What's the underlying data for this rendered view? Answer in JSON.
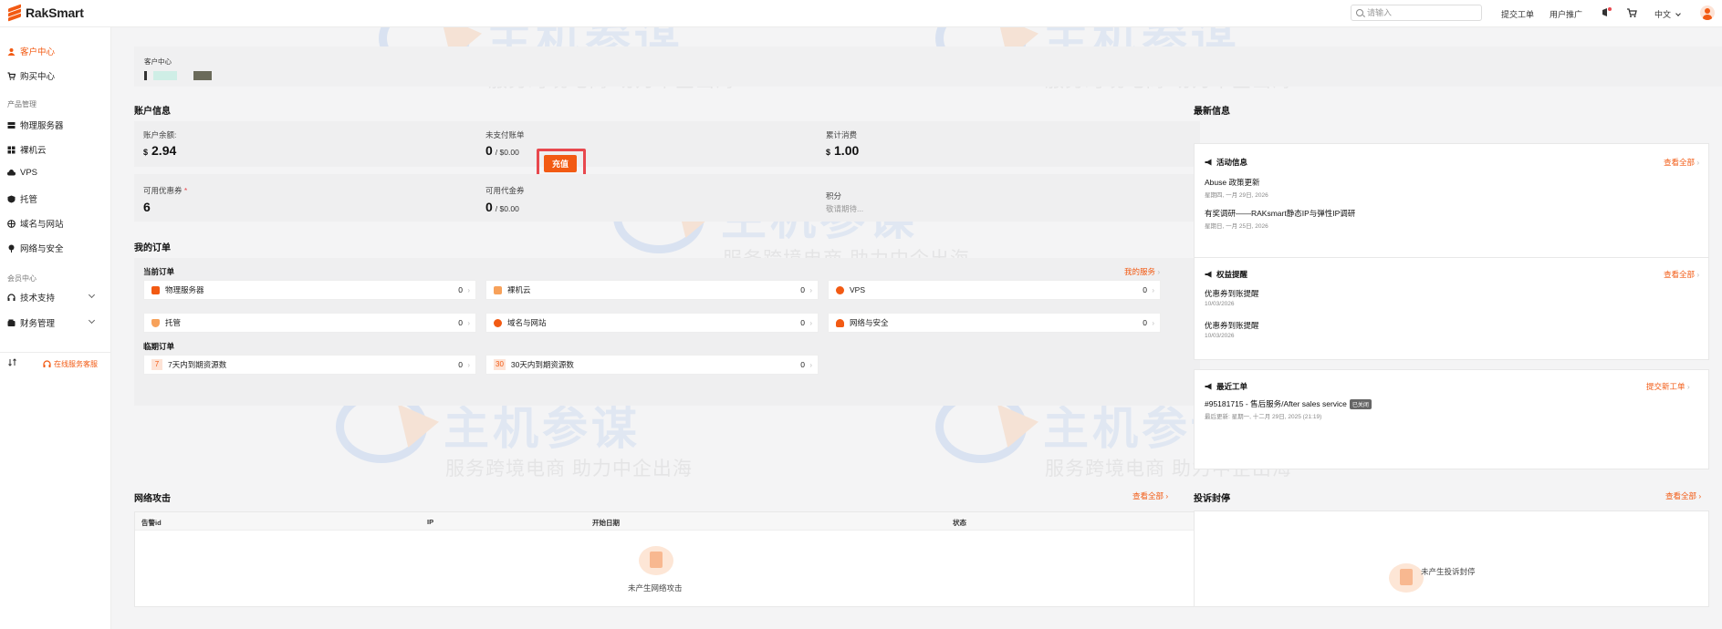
{
  "brand": {
    "name": "RakSmart",
    "accent": "#f25a13"
  },
  "header": {
    "search_placeholder": "请输入",
    "submit_ticket": "提交工单",
    "user_promo": "用户推广",
    "language": "中文",
    "icons": [
      "notification-icon",
      "cart-icon",
      "chevron-down-icon",
      "avatar"
    ]
  },
  "sidebar": {
    "customer_center": "客户中心",
    "purchase_center": "购买中心",
    "product_group": "产品管理",
    "products": [
      "物理服务器",
      "裸机云",
      "VPS",
      "托管",
      "域名与网站",
      "网络与安全"
    ],
    "member_group": "会员中心",
    "tech_support": "技术支持",
    "finance": "财务管理",
    "online_support": "在线服务客服"
  },
  "watermark": {
    "title": "主机参谋",
    "slogan": "服务跨境电商 助力中企出海"
  },
  "profile": {
    "label": "客户中心"
  },
  "account": {
    "title": "账户信息",
    "balance_label": "账户余额:",
    "balance_currency": "$",
    "balance_value": "2.94",
    "recharge": "充值",
    "unpaid_label": "未支付账单",
    "unpaid_value": "0",
    "unpaid_sub": "/ $0.00",
    "spent_label": "累计消费",
    "spent_currency": "$",
    "spent_value": "1.00",
    "coupons_label": "可用优惠券",
    "coupons_required": "*",
    "coupons_value": "6",
    "vouchers_label": "可用代金券",
    "vouchers_value": "0",
    "vouchers_sub": "/ $0.00",
    "points_label": "积分",
    "points_value": "敬请期待..."
  },
  "orders": {
    "title": "我的订单",
    "current_title": "当前订单",
    "my_services": "我的服务",
    "current": [
      {
        "name": "物理服务器",
        "count": "0"
      },
      {
        "name": "裸机云",
        "count": "0"
      },
      {
        "name": "VPS",
        "count": "0"
      },
      {
        "name": "托管",
        "count": "0"
      },
      {
        "name": "域名与网站",
        "count": "0"
      },
      {
        "name": "网络与安全",
        "count": "0"
      }
    ],
    "expiring_title": "临期订单",
    "expiring": [
      {
        "badge": "7",
        "name": "7天内到期资源数",
        "count": "0"
      },
      {
        "badge": "30",
        "name": "30天内到期资源数",
        "count": "0"
      }
    ]
  },
  "attack": {
    "title": "网络攻击",
    "view_all": "查看全部",
    "columns": [
      "告警id",
      "IP",
      "开始日期",
      "状态"
    ],
    "empty": "未产生网络攻击"
  },
  "news": {
    "title": "最新信息",
    "activity": {
      "title": "活动信息",
      "view_all": "查看全部",
      "items": [
        {
          "title": "Abuse 政策更新",
          "date": "星期四, 一月 29日, 2026"
        },
        {
          "title": "有奖调研——RAKsmart静态IP与弹性IP调研",
          "date": "星期日, 一月 25日, 2026"
        }
      ]
    },
    "rights": {
      "title": "权益提醒",
      "view_all": "查看全部",
      "items": [
        {
          "title": "优惠券到账提醒",
          "date": "10/03/2026"
        },
        {
          "title": "优惠券到账提醒",
          "date": "10/03/2026"
        }
      ]
    },
    "tickets": {
      "title": "最近工单",
      "submit": "提交新工单",
      "item_title": "#95181715 - 售后服务/After sales service",
      "item_badge": "已关闭",
      "item_meta": "最后更新: 星期一, 十二月 29日, 2025 (21:19)"
    }
  },
  "complaint": {
    "title": "投诉封停",
    "view_all": "查看全部",
    "empty": "未产生投诉封停"
  }
}
